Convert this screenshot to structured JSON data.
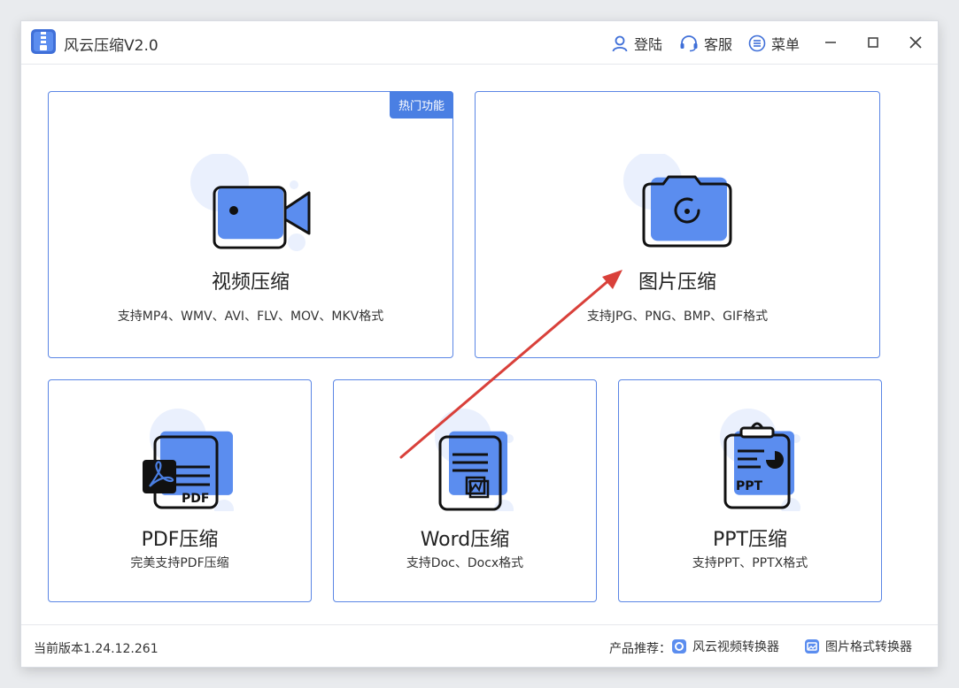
{
  "app": {
    "title": "风云压缩V2.0",
    "logo_icon": "zip-file-icon"
  },
  "header": {
    "login_label": "登陆",
    "service_label": "客服",
    "menu_label": "菜单"
  },
  "cards": {
    "video": {
      "title": "视频压缩",
      "desc": "支持MP4、WMV、AVI、FLV、MOV、MKV格式",
      "badge": "热门功能",
      "icon": "video-camera-icon"
    },
    "image": {
      "title": "图片压缩",
      "desc": "支持JPG、PNG、BMP、GIF格式",
      "icon": "camera-icon"
    },
    "pdf": {
      "title": "PDF压缩",
      "desc": "完美支持PDF压缩",
      "icon": "pdf-document-icon",
      "icon_text": "PDF"
    },
    "word": {
      "title": "Word压缩",
      "desc": "支持Doc、Docx格式",
      "icon": "word-document-icon"
    },
    "ppt": {
      "title": "PPT压缩",
      "desc": "支持PPT、PPTX格式",
      "icon": "ppt-clipboard-icon",
      "icon_text": "PPT"
    }
  },
  "footer": {
    "version": "当前版本1.24.12.261",
    "recommend_label": "产品推荐：",
    "rec_video_converter": "风云视频转换器",
    "rec_image_converter": "图片格式转换器"
  },
  "colors": {
    "accent": "#4a7fe3",
    "icon_fill": "#5b8def",
    "icon_bg_circle": "#eaf0fd",
    "card_border": "#5b86e5",
    "annotation_arrow": "#d9403a"
  }
}
